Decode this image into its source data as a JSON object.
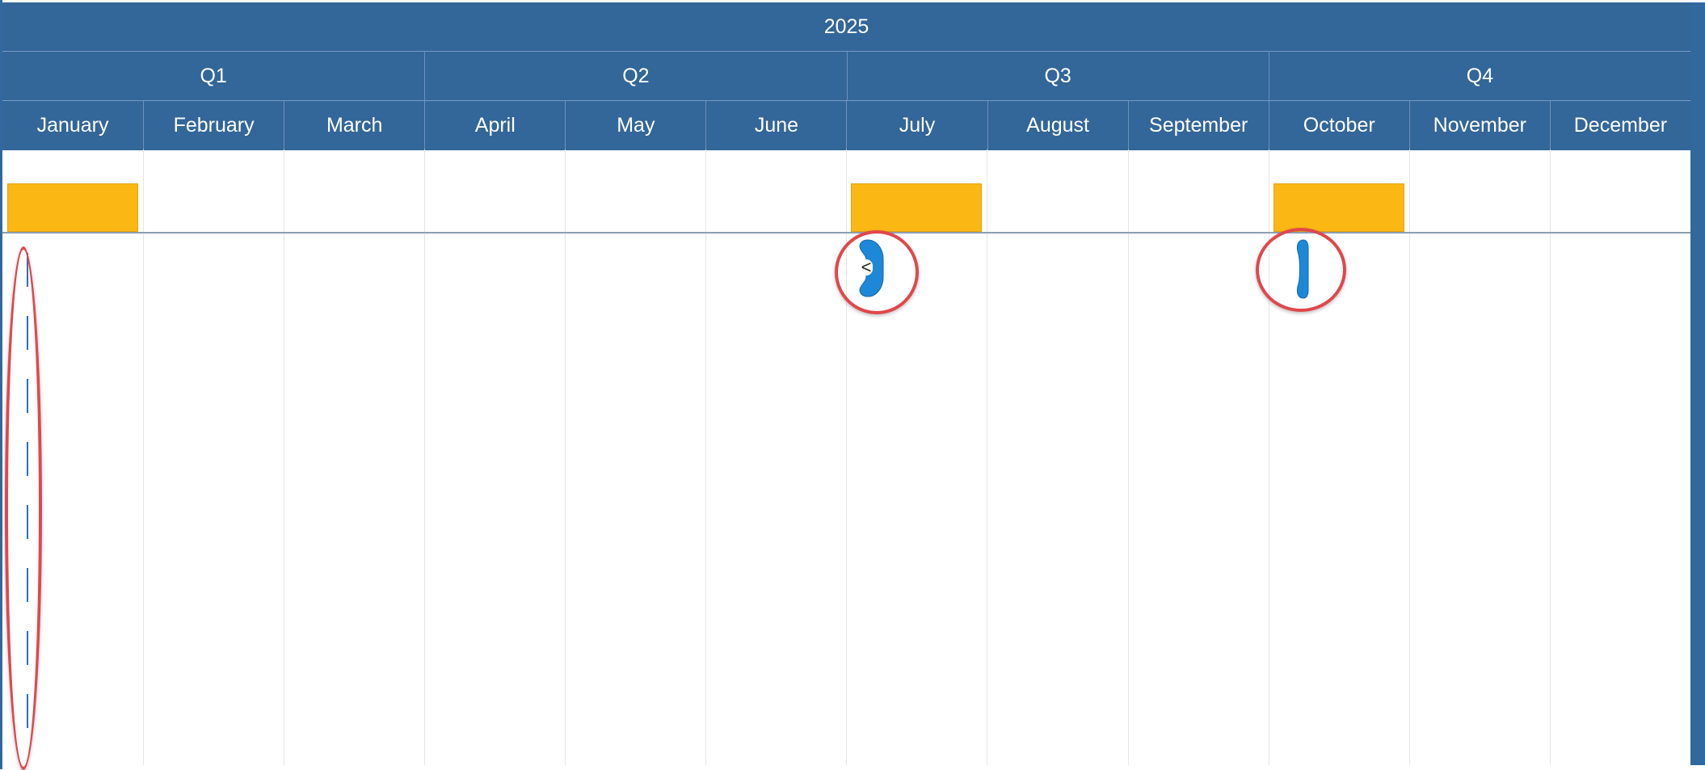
{
  "year": "2025",
  "quarters": [
    "Q1",
    "Q2",
    "Q3",
    "Q4"
  ],
  "months": [
    "January",
    "February",
    "March",
    "April",
    "May",
    "June",
    "July",
    "August",
    "September",
    "October",
    "November",
    "December"
  ],
  "milestone_bars": [
    {
      "month": "January"
    },
    {
      "month": "July"
    },
    {
      "month": "October"
    }
  ],
  "handles": [
    {
      "name": "collapse-left-handle",
      "glyph": "<"
    },
    {
      "name": "expand-handle",
      "glyph": ""
    }
  ],
  "colors": {
    "header_bg": "#336699",
    "bar": "#fbb714",
    "handle": "#1e88d8",
    "highlight_ring": "#e0474c",
    "dash": "#2a6fb8"
  }
}
